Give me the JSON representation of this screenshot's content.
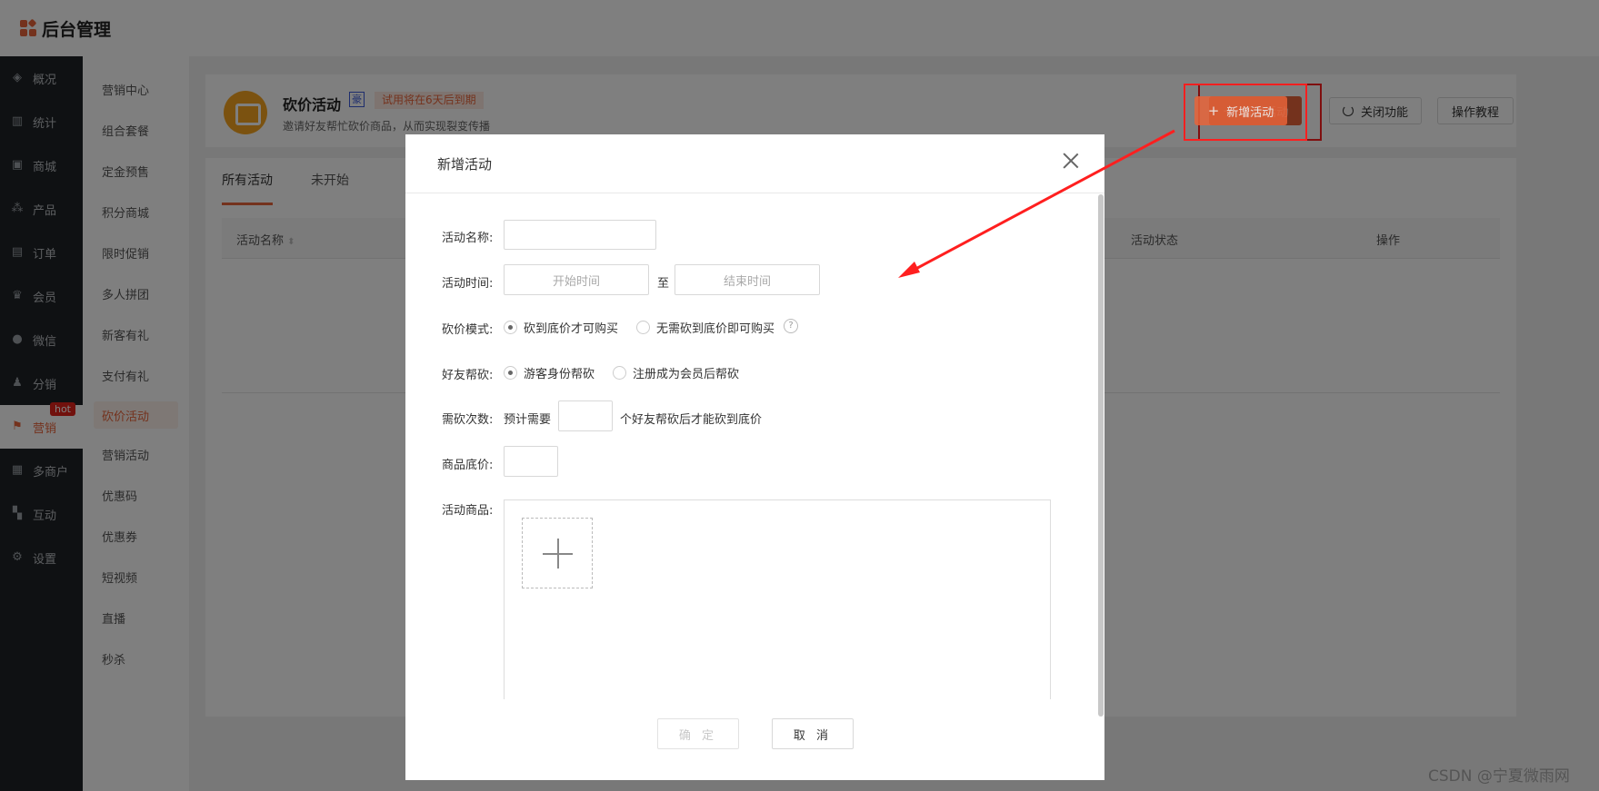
{
  "app": {
    "title": "后台管理"
  },
  "leftnav": {
    "items": [
      {
        "label": "概况",
        "icon": "layers-icon"
      },
      {
        "label": "统计",
        "icon": "chart-icon"
      },
      {
        "label": "商城",
        "icon": "store-icon"
      },
      {
        "label": "产品",
        "icon": "grid-icon"
      },
      {
        "label": "订单",
        "icon": "clipboard-icon"
      },
      {
        "label": "会员",
        "icon": "crown-icon"
      },
      {
        "label": "微信",
        "icon": "wechat-icon"
      },
      {
        "label": "分销",
        "icon": "users-icon"
      },
      {
        "label": "营销",
        "icon": "flag-icon",
        "badge": "hot"
      },
      {
        "label": "多商户",
        "icon": "shop-icon"
      },
      {
        "label": "互动",
        "icon": "apps-icon"
      },
      {
        "label": "设置",
        "icon": "gear-icon"
      }
    ]
  },
  "subnav": {
    "items": [
      "营销中心",
      "组合套餐",
      "定金预售",
      "积分商城",
      "限时促销",
      "多人拼团",
      "新客有礼",
      "支付有礼",
      "砍价活动",
      "营销活动",
      "优惠码",
      "优惠券",
      "短视频",
      "直播",
      "秒杀"
    ]
  },
  "header": {
    "title": "砍价活动",
    "tag": "豪",
    "trial": "试用将在6天后到期",
    "desc": "邀请好友帮忙砍价商品，从而实现裂变传播",
    "add_button": "新增活动",
    "close_button": "关闭功能",
    "tutorial_button": "操作教程"
  },
  "tabs": [
    "所有活动",
    "未开始"
  ],
  "table": {
    "columns": [
      "活动名称",
      "活动状态",
      "操作"
    ]
  },
  "modal": {
    "title": "新增活动",
    "name_label": "活动名称:",
    "name_value": "",
    "time_label": "活动时间:",
    "start_placeholder": "开始时间",
    "time_sep": "至",
    "end_placeholder": "结束时间",
    "mode_label": "砍价模式:",
    "mode_opt1": "砍到底价才可购买",
    "mode_opt2": "无需砍到底价即可购买",
    "help": "?",
    "friend_label": "好友帮砍:",
    "friend_opt1": "游客身份帮砍",
    "friend_opt2": "注册成为会员后帮砍",
    "times_label": "需砍次数:",
    "times_prefix": "预计需要",
    "times_value": "",
    "times_suffix": "个好友帮砍后才能砍到底价",
    "floor_label": "商品底价:",
    "floor_value": "",
    "goods_label": "活动商品:",
    "confirm": "确 定",
    "cancel": "取 消"
  },
  "watermark": "CSDN @宁夏微雨网",
  "colors": {
    "accent": "#e8643a",
    "annotation": "#ff1f1f",
    "sidebar": "#1f2327"
  }
}
